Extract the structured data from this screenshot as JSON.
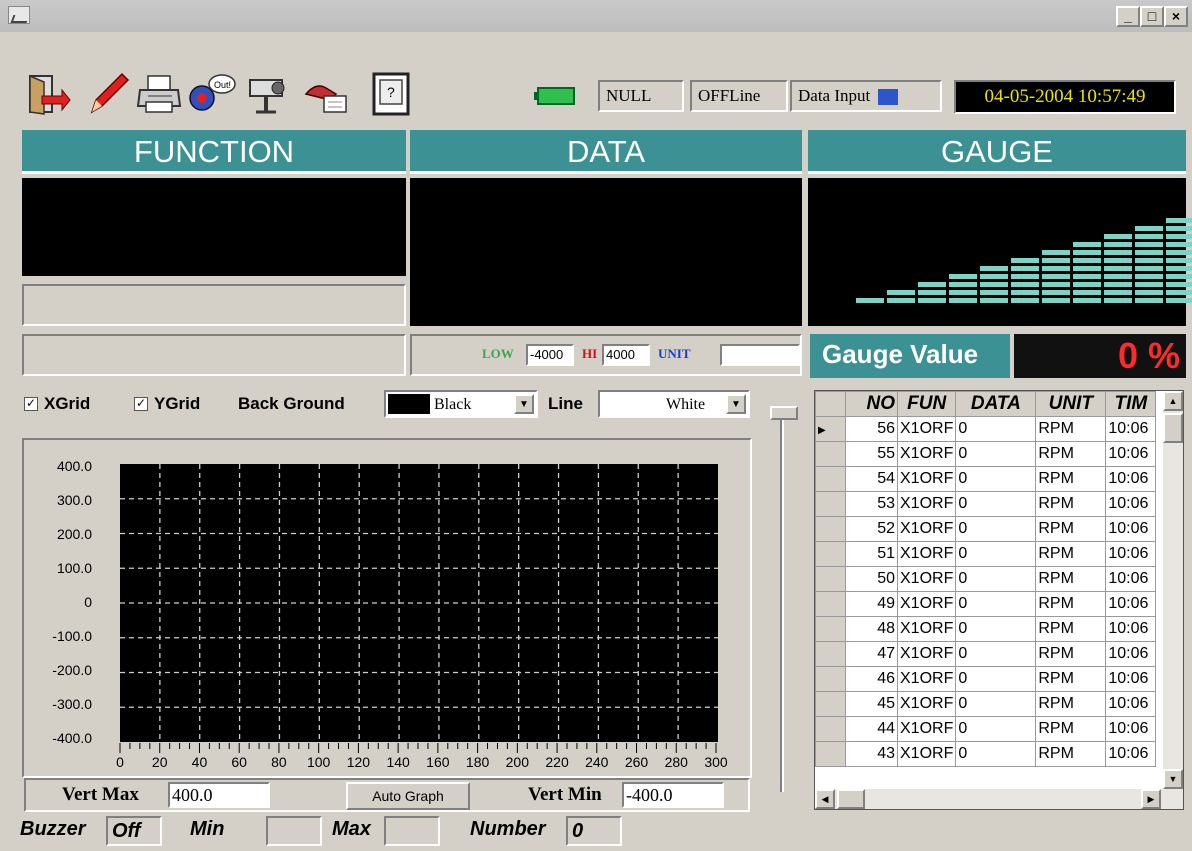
{
  "window": {
    "title": ""
  },
  "menu": {
    "items": [
      "",
      ""
    ]
  },
  "toolbar": {
    "icons": [
      "exit-icon",
      "pen-icon",
      "printer-icon",
      "sound-icon",
      "camera-icon",
      "hand-icon",
      "help-icon"
    ]
  },
  "status": {
    "null_label": "NULL",
    "offline_label": "OFFLine",
    "data_input_label": "Data Input",
    "datetime": "04-05-2004 10:57:49"
  },
  "panels": {
    "function": "FUNCTION",
    "data": "DATA",
    "gauge": "GAUGE"
  },
  "range": {
    "low_label": "LOW",
    "low_value": "-4000",
    "hi_label": "HI",
    "hi_value": "4000",
    "unit_label": "UNIT",
    "unit_value": ""
  },
  "gauge": {
    "label": "Gauge Value",
    "value": "0 %",
    "percent": 0
  },
  "options": {
    "xgrid_label": "XGrid",
    "xgrid_checked": true,
    "ygrid_label": "YGrid",
    "ygrid_checked": true,
    "background_label": "Back Ground",
    "background_value": "Black",
    "line_label": "Line",
    "line_value": "White"
  },
  "graph": {
    "y_ticks": [
      "400.0",
      "300.0",
      "200.0",
      "100.0",
      "0",
      "-100.0",
      "-200.0",
      "-300.0",
      "-400.0"
    ],
    "x_ticks": [
      "0",
      "20",
      "40",
      "60",
      "80",
      "100",
      "120",
      "140",
      "160",
      "180",
      "200",
      "220",
      "240",
      "260",
      "280",
      "300"
    ],
    "vert_max_label": "Vert Max",
    "vert_max_value": "400.0",
    "auto_graph_label": "Auto Graph",
    "vert_min_label": "Vert Min",
    "vert_min_value": "-400.0"
  },
  "bottom": {
    "buzzer_label": "Buzzer",
    "buzzer_value": "Off",
    "min_label": "Min",
    "min_value": "",
    "max_label": "Max",
    "max_value": "",
    "number_label": "Number",
    "number_value": "0"
  },
  "table": {
    "headers": [
      "NO",
      "FUN",
      "DATA",
      "UNIT",
      "TIM"
    ],
    "rows": [
      [
        "56",
        "X1ORF",
        "0",
        "RPM",
        "10:06"
      ],
      [
        "55",
        "X1ORF",
        "0",
        "RPM",
        "10:06"
      ],
      [
        "54",
        "X1ORF",
        "0",
        "RPM",
        "10:06"
      ],
      [
        "53",
        "X1ORF",
        "0",
        "RPM",
        "10:06"
      ],
      [
        "52",
        "X1ORF",
        "0",
        "RPM",
        "10:06"
      ],
      [
        "51",
        "X1ORF",
        "0",
        "RPM",
        "10:06"
      ],
      [
        "50",
        "X1ORF",
        "0",
        "RPM",
        "10:06"
      ],
      [
        "49",
        "X1ORF",
        "0",
        "RPM",
        "10:06"
      ],
      [
        "48",
        "X1ORF",
        "0",
        "RPM",
        "10:06"
      ],
      [
        "47",
        "X1ORF",
        "0",
        "RPM",
        "10:06"
      ],
      [
        "46",
        "X1ORF",
        "0",
        "RPM",
        "10:06"
      ],
      [
        "45",
        "X1ORF",
        "0",
        "RPM",
        "10:06"
      ],
      [
        "44",
        "X1ORF",
        "0",
        "RPM",
        "10:06"
      ],
      [
        "43",
        "X1ORF",
        "0",
        "RPM",
        "10:06"
      ]
    ]
  },
  "colors": {
    "header_teal": "#3b9193",
    "gauge_bar": "#7fd3c6",
    "datetime_text": "#e6e600",
    "gauge_value_red": "#ff2b2b",
    "low_green": "#3fa34d",
    "hi_red": "#d01010",
    "unit_blue": "#1a3fd0"
  }
}
